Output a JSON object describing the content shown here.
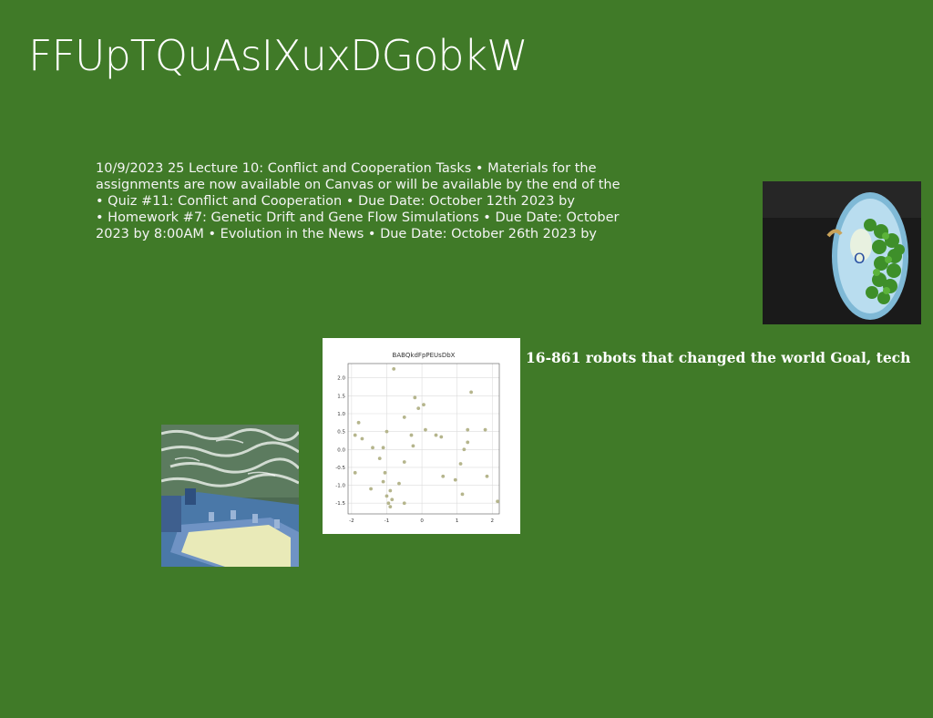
{
  "slide": {
    "title": "FFUpTQuAsIXuxDGobkW",
    "body_lines": [
      "10/9/2023 25 Lecture 10: Conflict and Cooperation Tasks • Materials for the",
      "assignments are now available on Canvas or will be available by the end of the",
      "• Quiz #11: Conflict and Cooperation • Due Date: October 12th 2023 by",
      "• Homework #7: Genetic Drift and Gene Flow Simulations • Due Date: October",
      "2023 by 8:00AM • Evolution in the News • Due Date: October 26th 2023 by"
    ],
    "caption": "16-861 robots that changed the world Goal, tech",
    "background_color": "#407a28"
  },
  "chart_data": {
    "type": "scatter",
    "title": "BABQkdFpPEUsDbX",
    "xlabel": "",
    "ylabel": "",
    "xlim": [
      -2.1,
      2.2
    ],
    "ylim": [
      -1.8,
      2.4
    ],
    "x_ticks": [
      "-2",
      "-1",
      "0",
      "1",
      "2"
    ],
    "y_ticks": [
      "2.0",
      "1.5",
      "1.0",
      "0.5",
      "0.0",
      "-0.5",
      "-1.0",
      "-1.5"
    ],
    "grid": true,
    "point_color": "#b5b58c",
    "points": [
      [
        -0.8,
        2.25
      ],
      [
        1.4,
        1.6
      ],
      [
        -0.2,
        1.45
      ],
      [
        -0.1,
        1.15
      ],
      [
        0.05,
        1.25
      ],
      [
        -1.8,
        0.75
      ],
      [
        -1.7,
        0.3
      ],
      [
        -1.9,
        0.4
      ],
      [
        -1.0,
        0.5
      ],
      [
        -0.5,
        0.9
      ],
      [
        -0.3,
        0.4
      ],
      [
        0.1,
        0.55
      ],
      [
        0.4,
        0.4
      ],
      [
        0.55,
        0.35
      ],
      [
        1.3,
        0.55
      ],
      [
        1.8,
        0.55
      ],
      [
        1.3,
        0.2
      ],
      [
        1.2,
        0.0
      ],
      [
        -1.4,
        0.05
      ],
      [
        -1.1,
        0.05
      ],
      [
        -0.25,
        0.1
      ],
      [
        -1.2,
        -0.25
      ],
      [
        -0.5,
        -0.35
      ],
      [
        1.1,
        -0.4
      ],
      [
        -1.05,
        -0.65
      ],
      [
        -1.9,
        -0.65
      ],
      [
        0.6,
        -0.75
      ],
      [
        1.85,
        -0.75
      ],
      [
        0.95,
        -0.85
      ],
      [
        -1.1,
        -0.9
      ],
      [
        -0.65,
        -0.95
      ],
      [
        -0.9,
        -1.15
      ],
      [
        -1.45,
        -1.1
      ],
      [
        1.15,
        -1.25
      ],
      [
        -1.0,
        -1.3
      ],
      [
        -0.85,
        -1.4
      ],
      [
        -0.5,
        -1.5
      ],
      [
        -0.95,
        -1.5
      ],
      [
        -0.9,
        -1.6
      ],
      [
        2.15,
        -1.45
      ]
    ]
  },
  "images": {
    "plate": "bowl of green peas on a blue patterned plate",
    "water": "waves over a blue rooftop pool area"
  }
}
